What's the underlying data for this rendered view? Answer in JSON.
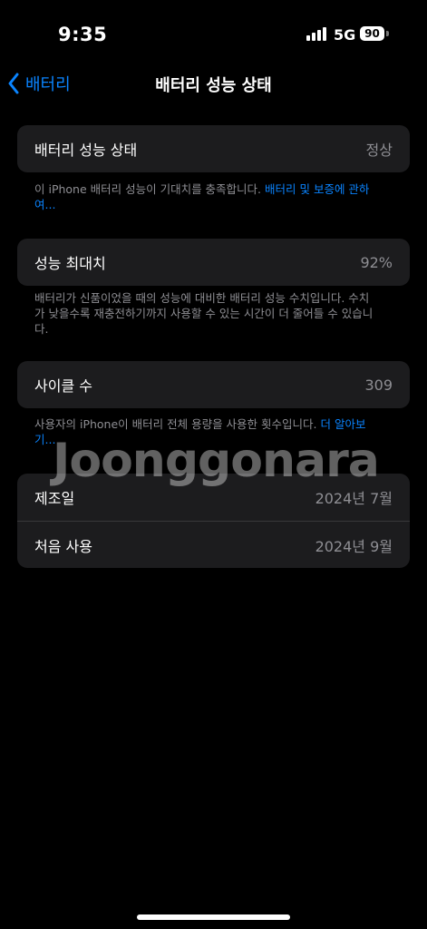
{
  "status_bar": {
    "time": "9:35",
    "network": "5G",
    "battery_level": "90",
    "signal_icon": "cellular-signal-icon",
    "battery_icon": "battery-icon"
  },
  "nav": {
    "back_label": "배터리",
    "back_icon": "chevron-left-icon",
    "title": "배터리 성능 상태"
  },
  "sections": {
    "health": {
      "label": "배터리 성능 상태",
      "value": "정상",
      "footer_text": "이 iPhone 배터리 성능이 기대치를 충족합니다. ",
      "footer_link": "배터리 및 보증에 관하여..."
    },
    "max_capacity": {
      "label": "성능 최대치",
      "value": "92%",
      "footer_text": "배터리가 신품이었을 때의 성능에 대비한 배터리 성능 수치입니다. 수치가 낮을수록 재충전하기까지 사용할 수 있는 시간이 더 줄어들 수 있습니다."
    },
    "cycle_count": {
      "label": "사이클 수",
      "value": "309",
      "footer_text": "사용자의 iPhone이 배터리 전체 용량을 사용한 횟수입니다. ",
      "footer_link": "더 알아보기..."
    },
    "dates": {
      "manufactured_label": "제조일",
      "manufactured_value": "2024년 7월",
      "first_use_label": "처음 사용",
      "first_use_value": "2024년 9월"
    }
  },
  "watermark": "Joonggonara",
  "colors": {
    "background": "#000000",
    "card": "#1c1c1e",
    "accent": "#0a84ff",
    "secondary_text": "#8e8e93"
  }
}
